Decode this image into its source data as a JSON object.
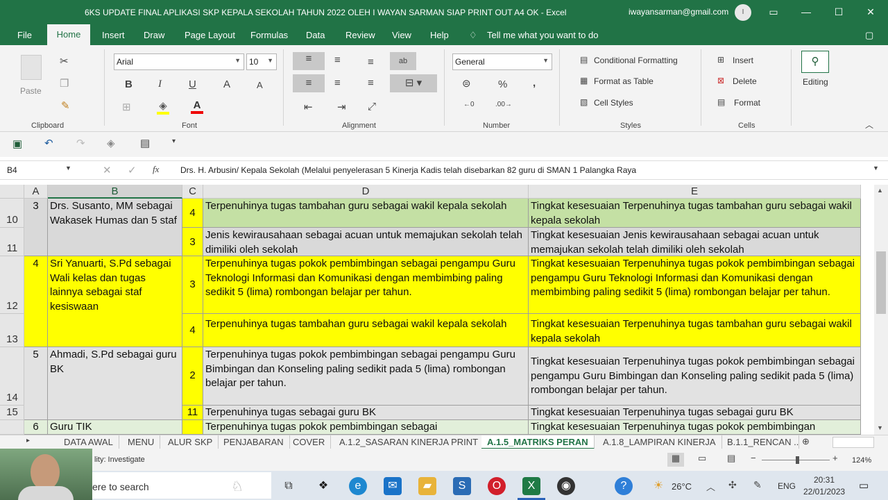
{
  "window": {
    "title": "6KS UPDATE FINAL APLIKASI SKP KEPALA SEKOLAH TAHUN 2022 OLEH I WAYAN SARMAN  SIAP PRINT OUT A4 OK  -  Excel",
    "user": "iwayansarman@gmail.com",
    "avatar": "I"
  },
  "menu": [
    "File",
    "Home",
    "Insert",
    "Draw",
    "Page Layout",
    "Formulas",
    "Data",
    "Review",
    "View",
    "Help"
  ],
  "tell_me": "Tell me what you want to do",
  "ribbon": {
    "clipboard": {
      "paste": "Paste",
      "label": "Clipboard"
    },
    "font": {
      "name": "Arial",
      "size": "10",
      "label": "Font",
      "bold": "B",
      "italic": "I",
      "underline": "U",
      "grow": "A",
      "shrink": "A"
    },
    "alignment": {
      "label": "Alignment"
    },
    "number": {
      "format": "General",
      "label": "Number",
      "percent": "%",
      "comma": ","
    },
    "styles": {
      "conditional": "Conditional Formatting",
      "table": "Format as Table",
      "cell": "Cell Styles",
      "label": "Styles"
    },
    "cells": {
      "insert": "Insert",
      "delete": "Delete",
      "format": "Format",
      "label": "Cells"
    },
    "editing": {
      "label": "Editing"
    }
  },
  "formula_bar": {
    "name_box": "B4",
    "fx": "fx",
    "formula": "Drs. H. Arbusin/ Kepala Sekolah (Melalui penyelerasan 5 Kinerja Kadis telah disebarkan 82  guru di SMAN 1 Palangka Raya"
  },
  "columns": [
    "A",
    "B",
    "C",
    "D",
    "E"
  ],
  "rows": [
    {
      "row": "10",
      "a": "3",
      "b": "Drs. Susanto, MM sebagai Wakasek Humas dan 5 staf",
      "c": "4",
      "d": "Terpenuhinya tugas tambahan guru sebagai wakil kepala sekolah",
      "e": "Tingkat kesesuaian Terpenuhinya tugas tambahan guru sebagai wakil kepala sekolah"
    },
    {
      "row": "11",
      "c": "3",
      "d": "Jenis kewirausahaan sebagai acuan untuk memajukan sekolah telah dimiliki oleh sekolah",
      "e": "Tingkat kesesuaian Jenis kewirausahaan sebagai acuan untuk memajukan sekolah telah dimiliki oleh sekolah"
    },
    {
      "row": "12",
      "a": "4",
      "b": "Sri Yanuarti, S.Pd sebagai Wali kelas dan tugas lainnya sebagai staf kesiswaan",
      "c": "3",
      "d": "Terpenuhinya tugas pokok pembimbingan  sebagai pengampu  Guru Teknologi Informasi dan Komunikasi dengan membimbing paling sedikit 5 (lima) rombongan belajar per tahun.",
      "e": "Tingkat kesesuaian Terpenuhinya tugas pokok pembimbingan sebagai pengampu  Guru Teknologi Informasi dan Komunikasi dengan membimbing paling sedikit 5 (lima) rombongan belajar per tahun."
    },
    {
      "row": "13",
      "c": "4",
      "d": "Terpenuhinya tugas tambahan guru sebagai wakil kepala sekolah",
      "e": "Tingkat kesesuaian Terpenuhinya tugas tambahan guru sebagai wakil kepala sekolah"
    },
    {
      "row": "14",
      "a": "5",
      "b": "Ahmadi, S.Pd sebagai guru BK",
      "c": "2",
      "d": "Terpenuhinya tugas pokok pembimbingan  sebagai pengampu Guru Bimbingan dan Konseling  paling sedikit pada  5 (lima) rombongan belajar per tahun.",
      "e": "Tingkat kesesuaian Terpenuhinya tugas pokok pembimbingan sebagai  pengampu Guru Bimbingan dan Konseling  paling sedikit pada  5 (lima) rombongan belajar per tahun."
    },
    {
      "row": "15",
      "c": "11",
      "d": "Terpenuhinya tugas sebagai guru BK",
      "e": "Tingkat kesesuaian Terpenuhinya tugas sebagai guru BK"
    },
    {
      "row": "",
      "a": "6",
      "b": "Guru TIK",
      "d": "Terpenuhinya tugas pokok pembimbingan  sebagai",
      "e": "Tingkat kesesuaian Terpenuhinya tugas pokok pembimbingan"
    }
  ],
  "sheets": [
    "DATA AWAL",
    "MENU",
    "ALUR SKP",
    "PENJABARAN",
    "COVER",
    "A.1.2_SASARAN KINERJA PRINT",
    "A.1.5_MATRIKS PERAN",
    "A.1.8_LAMPIRAN KINERJA",
    "B.1.1_RENCAN ..."
  ],
  "status": {
    "accessibility": "lity: Investigate",
    "zoom": "124%"
  },
  "taskbar": {
    "search": "ere to search",
    "weather": "26°C",
    "lang": "ENG",
    "time": "20:31",
    "date": "22/01/2023"
  },
  "colors": {
    "excel_green": "#217346",
    "row_green": "#c4e0a4",
    "row_yellow": "#ffff00",
    "row_grey": "#d9d9d9"
  }
}
